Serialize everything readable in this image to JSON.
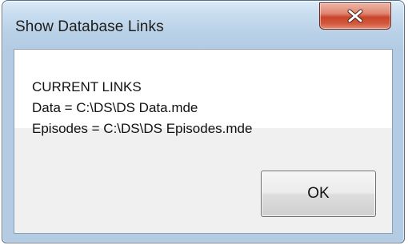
{
  "window": {
    "title": "Show Database Links",
    "close_icon": "close-icon"
  },
  "message": {
    "heading": "CURRENT LINKS",
    "lines": [
      "Data = C:\\DS\\DS Data.mde",
      "Episodes = C:\\DS\\DS Episodes.mde"
    ]
  },
  "buttons": {
    "ok_label": "OK"
  },
  "colors": {
    "close_button": "#c8452a",
    "frame": "#b3cce3"
  }
}
